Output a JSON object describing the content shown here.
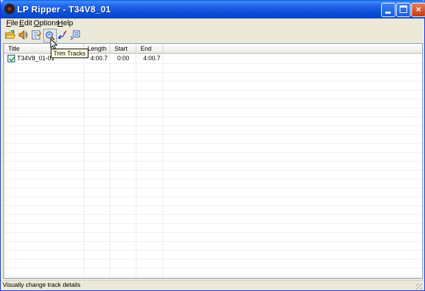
{
  "window": {
    "title": "LP Ripper - T34V8_01",
    "minimize_label": "",
    "maximize_label": "",
    "close_label": "×"
  },
  "menu": {
    "file": {
      "first": "F",
      "rest": "ile"
    },
    "edit": {
      "first": "E",
      "rest": "dit"
    },
    "options": {
      "first": "O",
      "rest": "ptions"
    },
    "help": {
      "first": "H",
      "rest": "elp"
    }
  },
  "toolbar": {
    "icons": [
      "open-folder-icon",
      "speaker-icon",
      "properties-icon",
      "trim-tracks-icon",
      "tracks-icon",
      "split-icon"
    ],
    "tooltip": "Trim Tracks"
  },
  "columns": [
    "Title",
    "Length",
    "Start",
    "End"
  ],
  "rows": [
    {
      "title": "T34V8_01-01",
      "length": "4:00.7",
      "start": "0:00",
      "end": "4:00.7",
      "checked": true
    }
  ],
  "status": {
    "text": "Visually change track details"
  },
  "colors": {
    "titlebar": "#0A4FD8",
    "close_button": "#C23C13",
    "face": "#ECE9D8",
    "tooltip_bg": "#FFFFE1"
  }
}
